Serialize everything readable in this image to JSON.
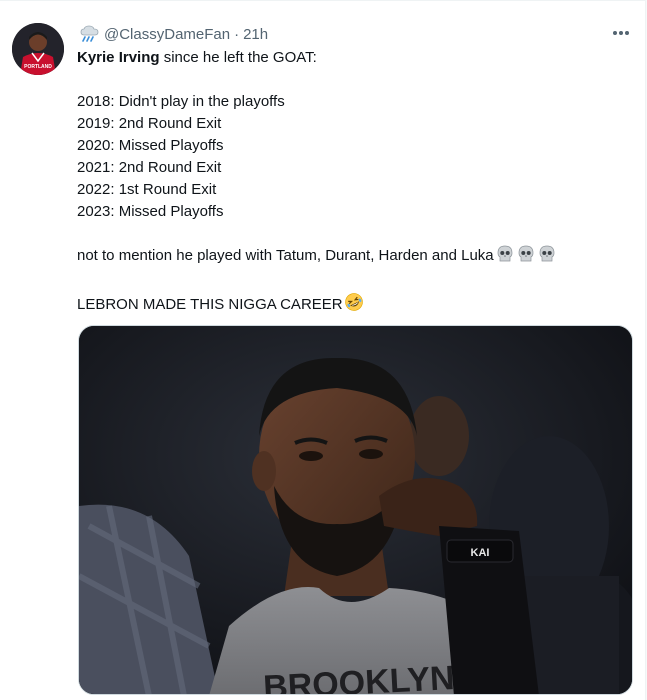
{
  "tweet": {
    "handle": "@ClassyDameFan",
    "separator": "·",
    "time": "21h",
    "mention": "Kyrie Irving",
    "first_line_rest": " since he left the GOAT:",
    "lines": [
      "2018: Didn't play in the playoffs",
      "2019: 2nd Round Exit",
      "2020: Missed Playoffs",
      "2021: 2nd Round Exit",
      "2022: 1st Round Exit",
      "2023: Missed Playoffs"
    ],
    "mention_line": "not to mention he played with Tatum, Durant, Harden and Luka",
    "last_line": "LEBRON MADE THIS NIGGA CAREER",
    "avatar_jersey_text": "PORTLAND",
    "photo": {
      "wristband_text": "KAI",
      "shirt_text": "BROOKLYN"
    }
  },
  "icons": {
    "badge": "cloud-rain-icon",
    "more": "more-horizontal-icon",
    "skull": "skull-emoji-icon",
    "laugh": "rolling-laughing-emoji-icon"
  },
  "colors": {
    "secondary_text": "#536471",
    "primary_text": "#0f1419",
    "jersey_red": "#c8102e"
  }
}
